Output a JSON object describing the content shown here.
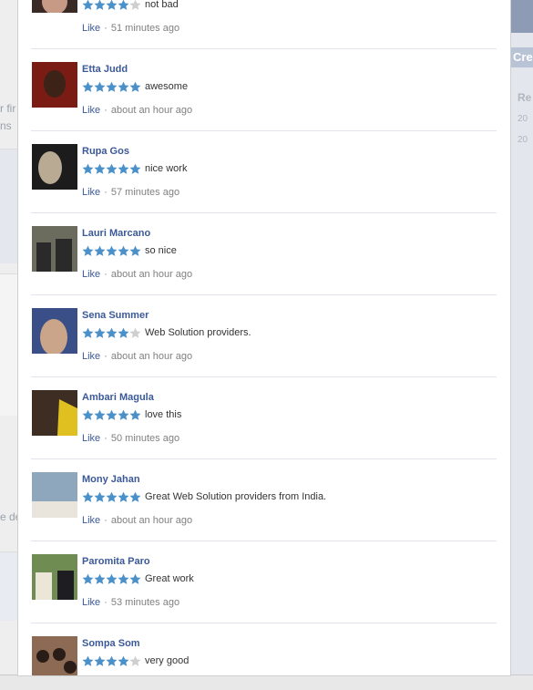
{
  "theme": {
    "link_color": "#3b5998",
    "star_filled": "#4a90c9",
    "star_empty": "#cfcfcf"
  },
  "background": {
    "left_fragments": [
      "r fir",
      "ns",
      "e de"
    ],
    "right_button": "Cre",
    "right_label": "Re",
    "right_years": [
      "20",
      "20"
    ]
  },
  "reviews": [
    {
      "name": "",
      "rating": 4,
      "comment": "not bad",
      "like_label": "Like",
      "separator": "·",
      "time": "51 minutes ago",
      "avatar": {
        "bg": "#3a2a25",
        "fg": "#c79a86"
      }
    },
    {
      "name": "Etta Judd",
      "rating": 5,
      "comment": "awesome",
      "like_label": "Like",
      "separator": "·",
      "time": "about an hour ago",
      "avatar": {
        "bg": "#7a1c14",
        "fg": "#3d2218"
      }
    },
    {
      "name": "Rupa Gos",
      "rating": 5,
      "comment": "nice work",
      "like_label": "Like",
      "separator": "·",
      "time": "57 minutes ago",
      "avatar": {
        "bg": "#1c1c1c",
        "fg": "#b9aa93"
      }
    },
    {
      "name": "Lauri Marcano",
      "rating": 5,
      "comment": "so nice",
      "like_label": "Like",
      "separator": "·",
      "time": "about an hour ago",
      "avatar": {
        "bg": "#6b6b5e",
        "fg": "#2a2a2a"
      }
    },
    {
      "name": "Sena Summer",
      "rating": 4,
      "comment": "Web Solution providers.",
      "like_label": "Like",
      "separator": "·",
      "time": "about an hour ago",
      "avatar": {
        "bg": "#3a4e87",
        "fg": "#caa58a"
      }
    },
    {
      "name": "Ambari Magula",
      "rating": 5,
      "comment": "love this",
      "like_label": "Like",
      "separator": "·",
      "time": "50 minutes ago",
      "avatar": {
        "bg": "#3d2d22",
        "fg": "#e0c020"
      }
    },
    {
      "name": "Mony Jahan",
      "rating": 5,
      "comment": "Great Web Solution providers from India.",
      "like_label": "Like",
      "separator": "·",
      "time": "about an hour ago",
      "avatar": {
        "bg": "#8fa7bd",
        "fg": "#e9e5dc"
      }
    },
    {
      "name": "Paromita Paro",
      "rating": 5,
      "comment": "Great work",
      "like_label": "Like",
      "separator": "·",
      "time": "53 minutes ago",
      "avatar": {
        "bg": "#6f8d52",
        "fg": "#1e1e22"
      }
    },
    {
      "name": "Sompa Som",
      "rating": 4,
      "comment": "very good",
      "like_label": "",
      "separator": "",
      "time": "",
      "avatar": {
        "bg": "#8d6a53",
        "fg": "#2a1c17"
      }
    }
  ]
}
